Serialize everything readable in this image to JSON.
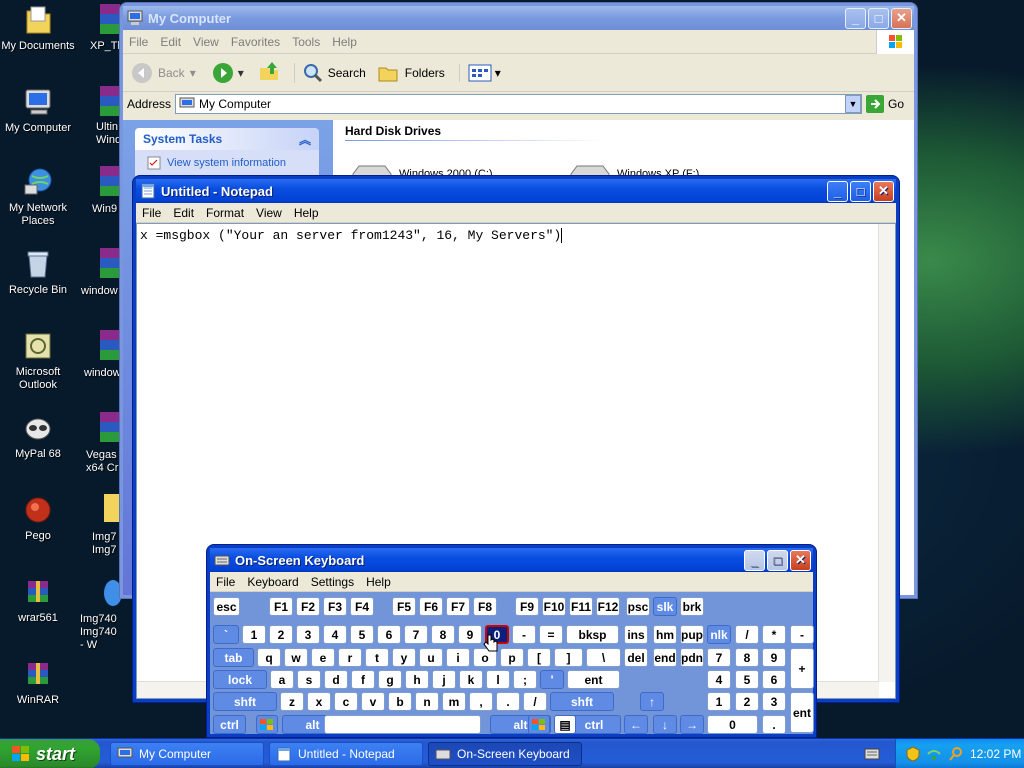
{
  "desktop": {
    "icons": [
      {
        "label": "My Documents",
        "icon": "folder-icon"
      },
      {
        "label": "My Computer",
        "icon": "computer-icon"
      },
      {
        "label": "My Network Places",
        "icon": "network-icon"
      },
      {
        "label": "Recycle Bin",
        "icon": "recycle-bin-icon"
      },
      {
        "label": "Microsoft Outlook",
        "icon": "outlook-icon"
      },
      {
        "label": "MyPal 68",
        "icon": "mypal-icon"
      },
      {
        "label": "Pego",
        "icon": "pego-icon"
      },
      {
        "label": "wrar561",
        "icon": "winrar-icon"
      },
      {
        "label": "WinRAR",
        "icon": "winrar-icon"
      }
    ],
    "partial_icons": [
      "XP_Th",
      "Ultin Windo",
      "Win9",
      "window",
      "window",
      "Img740",
      "Vegas x64 Cr",
      "Img7 Img7",
      "Img740 Img740 - W"
    ]
  },
  "my_computer": {
    "title": "My Computer",
    "menu": [
      "File",
      "Edit",
      "View",
      "Favorites",
      "Tools",
      "Help"
    ],
    "toolbar": {
      "back": "Back",
      "search": "Search",
      "folders": "Folders"
    },
    "address_label": "Address",
    "address_value": "My Computer",
    "go": "Go",
    "system_tasks": "System Tasks",
    "view_system_info": "View system information",
    "hard_disk_drives": "Hard Disk Drives",
    "drives": [
      "Windows 2000 (C:)",
      "Windows XP (F:)"
    ]
  },
  "notepad": {
    "title": "Untitled - Notepad",
    "menu": [
      "File",
      "Edit",
      "Format",
      "View",
      "Help"
    ],
    "content": "x =msgbox (\"Your an server from1243\", 16, My Servers\")"
  },
  "osk": {
    "title": "On-Screen Keyboard",
    "menu": [
      "File",
      "Keyboard",
      "Settings",
      "Help"
    ],
    "rows": [
      [
        "esc",
        "F1",
        "F2",
        "F3",
        "F4",
        "F5",
        "F6",
        "F7",
        "F8",
        "F9",
        "F10",
        "F11",
        "F12",
        "psc",
        "slk",
        "brk"
      ],
      [
        "`",
        "1",
        "2",
        "3",
        "4",
        "5",
        "6",
        "7",
        "8",
        "9",
        "0",
        "-",
        "=",
        "bksp",
        "ins",
        "hm",
        "pup",
        "nlk",
        "/",
        "*",
        "-"
      ],
      [
        "tab",
        "q",
        "w",
        "e",
        "r",
        "t",
        "y",
        "u",
        "i",
        "o",
        "p",
        "[",
        "]",
        "\\",
        "del",
        "end",
        "pdn",
        "7",
        "8",
        "9",
        "+"
      ],
      [
        "lock",
        "a",
        "s",
        "d",
        "f",
        "g",
        "h",
        "j",
        "k",
        "l",
        ";",
        "'",
        "ent",
        "4",
        "5",
        "6"
      ],
      [
        "shft",
        "z",
        "x",
        "c",
        "v",
        "b",
        "n",
        "m",
        ",",
        ".",
        "/",
        "shft",
        "↑",
        "1",
        "2",
        "3",
        "ent"
      ],
      [
        "ctrl",
        "alt",
        "alt",
        "ctrl",
        "←",
        "↓",
        "→",
        "0",
        "."
      ]
    ]
  },
  "taskbar": {
    "start": "start",
    "buttons": [
      "My Computer",
      "Untitled - Notepad",
      "On-Screen Keyboard"
    ],
    "time": "12:02 PM"
  }
}
